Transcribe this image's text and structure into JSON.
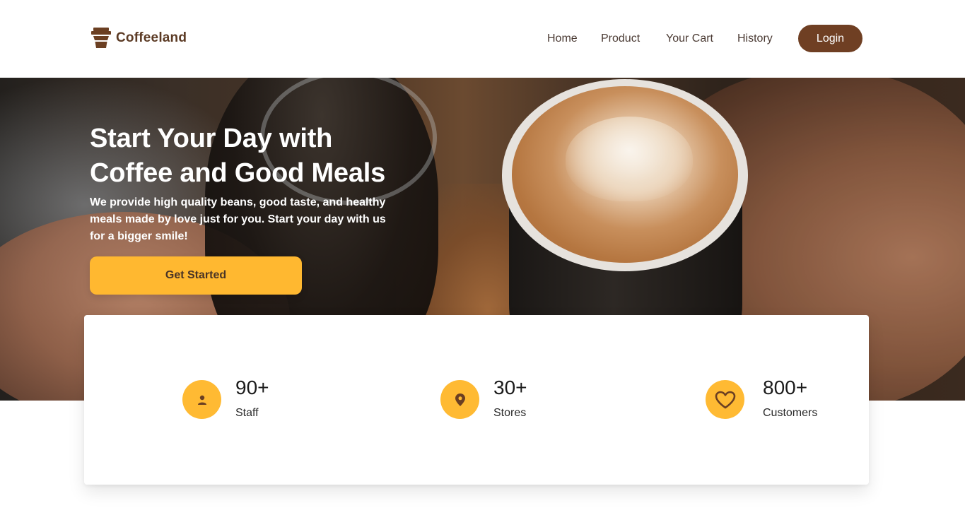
{
  "brand": {
    "name": "Coffeeland",
    "icon": "coffee-cup-icon",
    "color": "#5b3a24"
  },
  "nav": {
    "links": [
      "Home",
      "Product",
      "Your Cart",
      "History"
    ],
    "login_label": "Login",
    "login_color": "#6f3f23"
  },
  "hero": {
    "title": "Start Your Day with Coffee and Good Meals",
    "description": "We provide high quality beans, good taste, and healthy meals made by love just for you. Start your day with us for a bigger smile!",
    "cta_label": "Get Started",
    "cta_color": "#ffb830"
  },
  "stats": [
    {
      "value": "90+",
      "label": "Staff",
      "icon": "user-icon"
    },
    {
      "value": "30+",
      "label": "Stores",
      "icon": "location-pin-icon"
    },
    {
      "value": "800+",
      "label": "Customers",
      "icon": "heart-icon"
    }
  ],
  "accent_color": "#ffba33"
}
